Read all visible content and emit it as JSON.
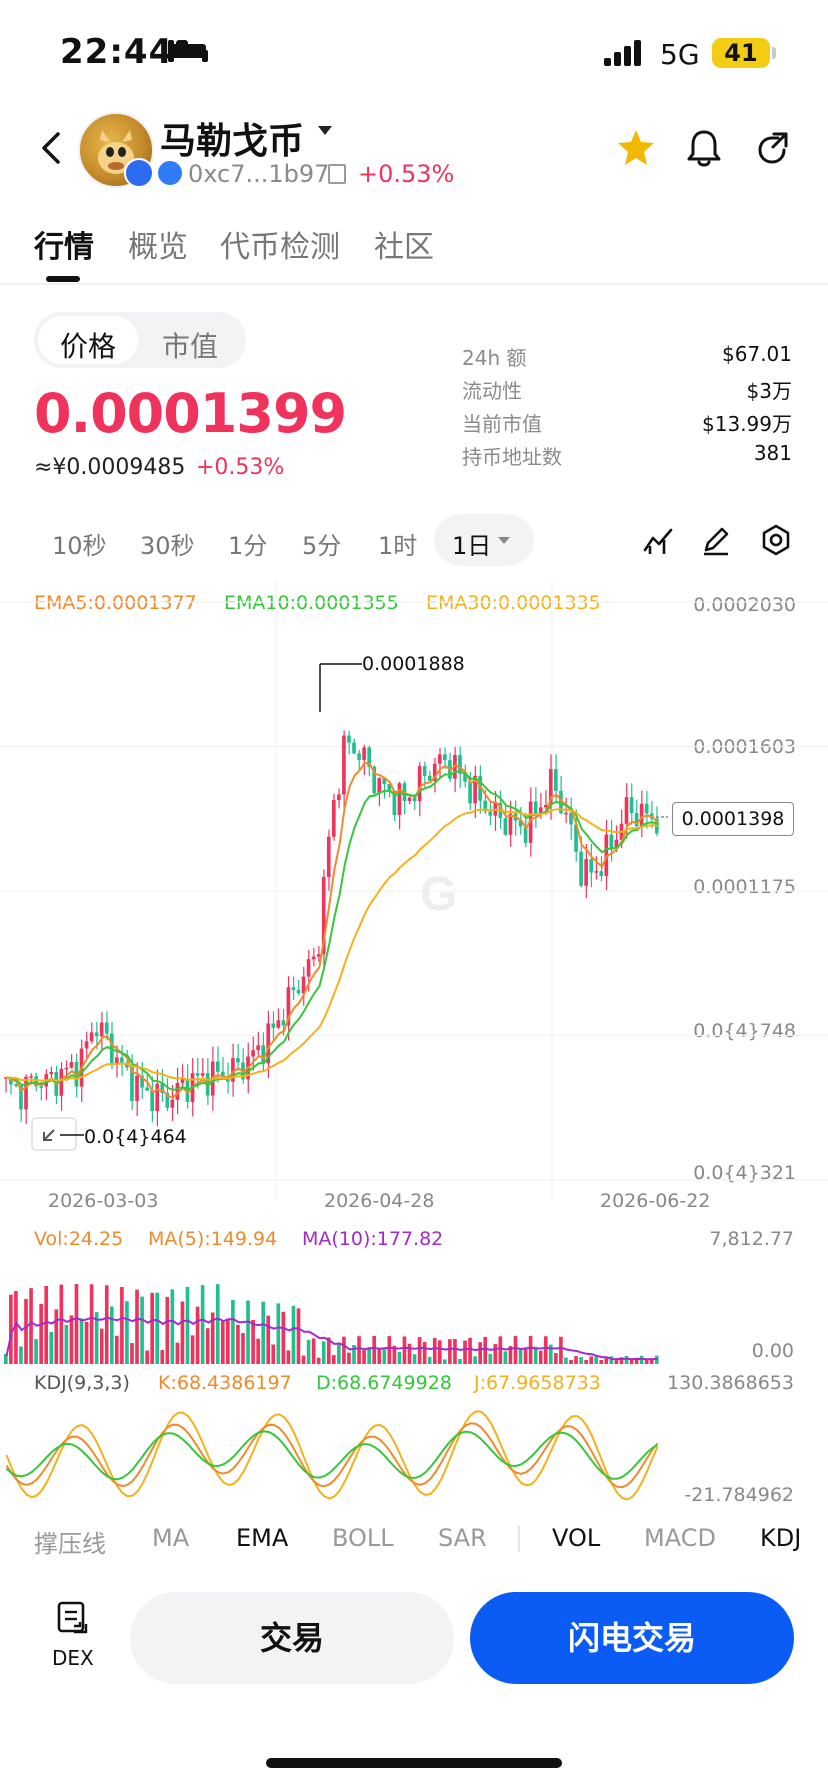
{
  "status_bar": {
    "time": "22:44",
    "network": "5G",
    "battery": "41"
  },
  "header": {
    "token_name": "马勒戈币",
    "address": "0xc7...1b97",
    "change": "+0.53%",
    "icons": [
      "back-icon",
      "token-avatar",
      "chain-icon",
      "copy-icon",
      "star-icon",
      "bell-icon",
      "share-icon"
    ]
  },
  "tabs": [
    "行情",
    "概览",
    "代币检测",
    "社区"
  ],
  "price_panel": {
    "segments": [
      "价格",
      "市值"
    ],
    "price": "0.0001399",
    "cny_price": "≈¥0.0009485",
    "cny_change": "+0.53%",
    "stats": [
      {
        "label": "24h  额",
        "value": "$67.01"
      },
      {
        "label": "流动性",
        "value": "$3万"
      },
      {
        "label": "当前市值",
        "value": "$13.99万"
      },
      {
        "label": "持币地址数",
        "value": "381"
      }
    ]
  },
  "timeframes": [
    "10秒",
    "30秒",
    "1分",
    "5分",
    "1时"
  ],
  "timeframe_selected": "1日",
  "chart_tools": [
    "indicator-icon",
    "draw-pen-icon",
    "settings-icon"
  ],
  "main_chart": {
    "ema5": "EMA5:0.0001377",
    "ema10": "EMA10:0.0001355",
    "ema30": "EMA30:0.0001335",
    "y_ticks": [
      "0.0002030",
      "0.0001603",
      "0.0001175",
      "0.0{4}748",
      "0.0{4}321"
    ],
    "high_marker": "0.0001888",
    "low_marker": "0.0{4}464",
    "last_price_tag": "0.0001398",
    "x_ticks": [
      "2026-03-03",
      "2026-04-28",
      "2026-06-22"
    ],
    "colors": {
      "up": "#f0335d",
      "down": "#1fbf8f",
      "ema5": "#f08a2b",
      "ema10": "#34c73a",
      "ema30": "#f3b11b"
    }
  },
  "volume_panel": {
    "vol": "Vol:24.25",
    "ma5": "MA(5):149.94",
    "ma10": "MA(10):177.82",
    "y_max": "7,812.77",
    "y_min": "0.00"
  },
  "kdj_panel": {
    "title": "KDJ(9,3,3)",
    "k": "K:68.4386197",
    "d": "D:68.6749928",
    "j": "J:67.9658733",
    "y_max": "130.3868653",
    "y_min": "-21.784962"
  },
  "indicators": [
    "撑压线",
    "MA",
    "EMA",
    "BOLL",
    "SAR",
    "VOL",
    "MACD",
    "KDJ"
  ],
  "actions": {
    "dex": "DEX",
    "trade": "交易",
    "flash_trade": "闪电交易"
  },
  "chart_data": {
    "type": "candlestick",
    "x": [
      "2026-03-03",
      "2026-04-28",
      "2026-06-22"
    ],
    "ylim": [
      3.21e-05,
      0.000203
    ],
    "y_ticks": [
      0.000203,
      0.0001603,
      0.0001175,
      7.48e-05,
      3.21e-05
    ],
    "high": 0.0001888,
    "low": 4.64e-05,
    "last": 0.0001398,
    "close_trend": [
      6e-05,
      5.8e-05,
      6.2e-05,
      6.1e-05,
      6.4e-05,
      6.6e-05,
      7.9e-05,
      7.2e-05,
      6.4e-05,
      5.9e-05,
      5.7e-05,
      5.6e-05,
      6e-05,
      6.2e-05,
      6.3e-05,
      6.4e-05,
      6.6e-05,
      7e-05,
      7.6e-05,
      8.4e-05,
      9.2e-05,
      9.8e-05,
      0.00014,
      0.000162,
      0.000158,
      0.00015,
      0.000146,
      0.000144,
      0.00015,
      0.000155,
      0.000156,
      0.00015,
      0.000145,
      0.00014,
      0.000138,
      0.000136,
      0.000142,
      0.00015,
      0.000138,
      0.000122,
      0.000124,
      0.000132,
      0.000142,
      0.00014,
      0.000139
    ],
    "series": [
      {
        "name": "EMA5",
        "value": 0.0001377
      },
      {
        "name": "EMA10",
        "value": 0.0001355
      },
      {
        "name": "EMA30",
        "value": 0.0001335
      }
    ]
  }
}
